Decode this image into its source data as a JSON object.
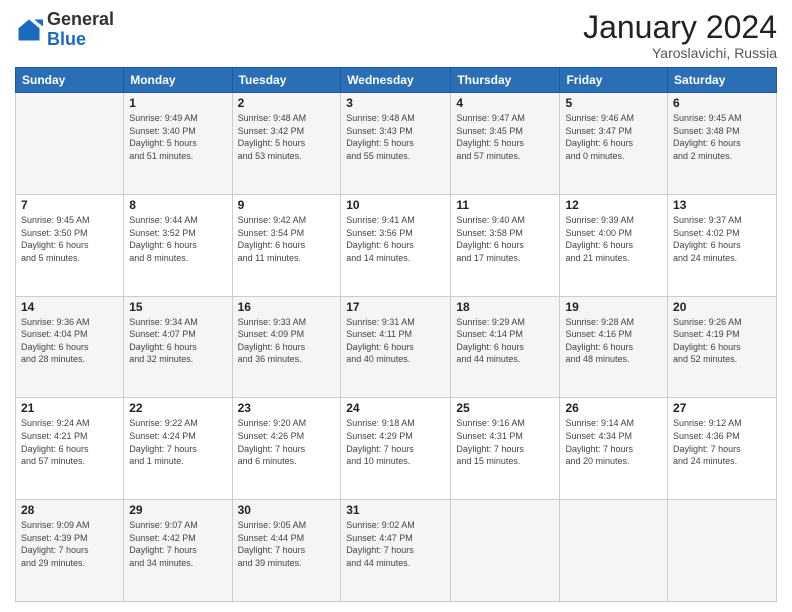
{
  "header": {
    "logo_general": "General",
    "logo_blue": "Blue",
    "month_title": "January 2024",
    "location": "Yaroslavichi, Russia"
  },
  "weekdays": [
    "Sunday",
    "Monday",
    "Tuesday",
    "Wednesday",
    "Thursday",
    "Friday",
    "Saturday"
  ],
  "weeks": [
    [
      {
        "day": "",
        "detail": ""
      },
      {
        "day": "1",
        "detail": "Sunrise: 9:49 AM\nSunset: 3:40 PM\nDaylight: 5 hours\nand 51 minutes."
      },
      {
        "day": "2",
        "detail": "Sunrise: 9:48 AM\nSunset: 3:42 PM\nDaylight: 5 hours\nand 53 minutes."
      },
      {
        "day": "3",
        "detail": "Sunrise: 9:48 AM\nSunset: 3:43 PM\nDaylight: 5 hours\nand 55 minutes."
      },
      {
        "day": "4",
        "detail": "Sunrise: 9:47 AM\nSunset: 3:45 PM\nDaylight: 5 hours\nand 57 minutes."
      },
      {
        "day": "5",
        "detail": "Sunrise: 9:46 AM\nSunset: 3:47 PM\nDaylight: 6 hours\nand 0 minutes."
      },
      {
        "day": "6",
        "detail": "Sunrise: 9:45 AM\nSunset: 3:48 PM\nDaylight: 6 hours\nand 2 minutes."
      }
    ],
    [
      {
        "day": "7",
        "detail": "Sunrise: 9:45 AM\nSunset: 3:50 PM\nDaylight: 6 hours\nand 5 minutes."
      },
      {
        "day": "8",
        "detail": "Sunrise: 9:44 AM\nSunset: 3:52 PM\nDaylight: 6 hours\nand 8 minutes."
      },
      {
        "day": "9",
        "detail": "Sunrise: 9:42 AM\nSunset: 3:54 PM\nDaylight: 6 hours\nand 11 minutes."
      },
      {
        "day": "10",
        "detail": "Sunrise: 9:41 AM\nSunset: 3:56 PM\nDaylight: 6 hours\nand 14 minutes."
      },
      {
        "day": "11",
        "detail": "Sunrise: 9:40 AM\nSunset: 3:58 PM\nDaylight: 6 hours\nand 17 minutes."
      },
      {
        "day": "12",
        "detail": "Sunrise: 9:39 AM\nSunset: 4:00 PM\nDaylight: 6 hours\nand 21 minutes."
      },
      {
        "day": "13",
        "detail": "Sunrise: 9:37 AM\nSunset: 4:02 PM\nDaylight: 6 hours\nand 24 minutes."
      }
    ],
    [
      {
        "day": "14",
        "detail": "Sunrise: 9:36 AM\nSunset: 4:04 PM\nDaylight: 6 hours\nand 28 minutes."
      },
      {
        "day": "15",
        "detail": "Sunrise: 9:34 AM\nSunset: 4:07 PM\nDaylight: 6 hours\nand 32 minutes."
      },
      {
        "day": "16",
        "detail": "Sunrise: 9:33 AM\nSunset: 4:09 PM\nDaylight: 6 hours\nand 36 minutes."
      },
      {
        "day": "17",
        "detail": "Sunrise: 9:31 AM\nSunset: 4:11 PM\nDaylight: 6 hours\nand 40 minutes."
      },
      {
        "day": "18",
        "detail": "Sunrise: 9:29 AM\nSunset: 4:14 PM\nDaylight: 6 hours\nand 44 minutes."
      },
      {
        "day": "19",
        "detail": "Sunrise: 9:28 AM\nSunset: 4:16 PM\nDaylight: 6 hours\nand 48 minutes."
      },
      {
        "day": "20",
        "detail": "Sunrise: 9:26 AM\nSunset: 4:19 PM\nDaylight: 6 hours\nand 52 minutes."
      }
    ],
    [
      {
        "day": "21",
        "detail": "Sunrise: 9:24 AM\nSunset: 4:21 PM\nDaylight: 6 hours\nand 57 minutes."
      },
      {
        "day": "22",
        "detail": "Sunrise: 9:22 AM\nSunset: 4:24 PM\nDaylight: 7 hours\nand 1 minute."
      },
      {
        "day": "23",
        "detail": "Sunrise: 9:20 AM\nSunset: 4:26 PM\nDaylight: 7 hours\nand 6 minutes."
      },
      {
        "day": "24",
        "detail": "Sunrise: 9:18 AM\nSunset: 4:29 PM\nDaylight: 7 hours\nand 10 minutes."
      },
      {
        "day": "25",
        "detail": "Sunrise: 9:16 AM\nSunset: 4:31 PM\nDaylight: 7 hours\nand 15 minutes."
      },
      {
        "day": "26",
        "detail": "Sunrise: 9:14 AM\nSunset: 4:34 PM\nDaylight: 7 hours\nand 20 minutes."
      },
      {
        "day": "27",
        "detail": "Sunrise: 9:12 AM\nSunset: 4:36 PM\nDaylight: 7 hours\nand 24 minutes."
      }
    ],
    [
      {
        "day": "28",
        "detail": "Sunrise: 9:09 AM\nSunset: 4:39 PM\nDaylight: 7 hours\nand 29 minutes."
      },
      {
        "day": "29",
        "detail": "Sunrise: 9:07 AM\nSunset: 4:42 PM\nDaylight: 7 hours\nand 34 minutes."
      },
      {
        "day": "30",
        "detail": "Sunrise: 9:05 AM\nSunset: 4:44 PM\nDaylight: 7 hours\nand 39 minutes."
      },
      {
        "day": "31",
        "detail": "Sunrise: 9:02 AM\nSunset: 4:47 PM\nDaylight: 7 hours\nand 44 minutes."
      },
      {
        "day": "",
        "detail": ""
      },
      {
        "day": "",
        "detail": ""
      },
      {
        "day": "",
        "detail": ""
      }
    ]
  ]
}
